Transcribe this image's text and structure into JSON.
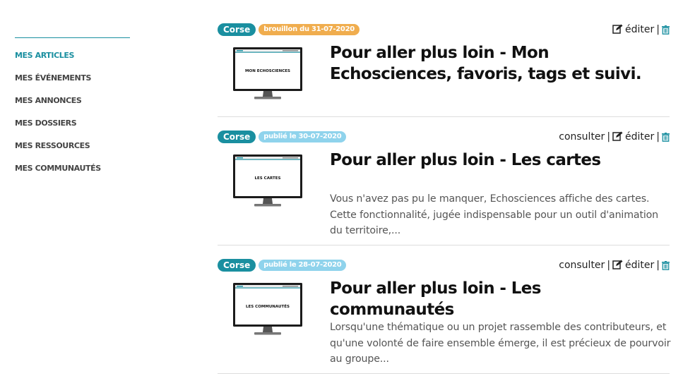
{
  "sidebar": {
    "items": [
      {
        "label": "MES ARTICLES",
        "active": true
      },
      {
        "label": "MES ÉVÉNEMENTS"
      },
      {
        "label": "MES ANNONCES"
      },
      {
        "label": "MES DOSSIERS"
      },
      {
        "label": "MES RESSOURCES"
      },
      {
        "label": "MES COMMUNAUTÉS"
      }
    ]
  },
  "actions": {
    "consult_label": "consulter",
    "edit_label": "éditer",
    "separator": "|",
    "edit_icon": "edit-icon",
    "delete_icon": "trash-icon"
  },
  "articles": [
    {
      "tag": "Corse",
      "status": "brouillon du 31-07-2020",
      "status_type": "draft",
      "thumb_label": "MON ECHOSCIENCES",
      "title": "Pour aller plus loin - Mon Echosciences, favoris, tags et suivi.",
      "excerpt": ""
    },
    {
      "tag": "Corse",
      "status": "publié le 30-07-2020",
      "status_type": "published",
      "thumb_label": "LES CARTES",
      "title": "Pour aller plus loin - Les cartes",
      "excerpt": "Vous n'avez pas pu le manquer, Echosciences affiche des cartes. Cette fonctionnalité, jugée indispensable pour un outil d'animation du territoire,..."
    },
    {
      "tag": "Corse",
      "status": "publié le 28-07-2020",
      "status_type": "published",
      "thumb_label": "LES COMMUNAUTÉS",
      "title": "Pour aller plus loin - Les communautés",
      "excerpt": "Lorsqu'une thématique ou un projet rassemble des contributeurs, et qu'une volonté de faire ensemble émerge, il est précieux de pourvoir au groupe..."
    }
  ],
  "colors": {
    "accent": "#1a8fa0",
    "draft": "#f0ad4e",
    "published": "#8fd3ec",
    "trash": "#1a8fa0"
  }
}
